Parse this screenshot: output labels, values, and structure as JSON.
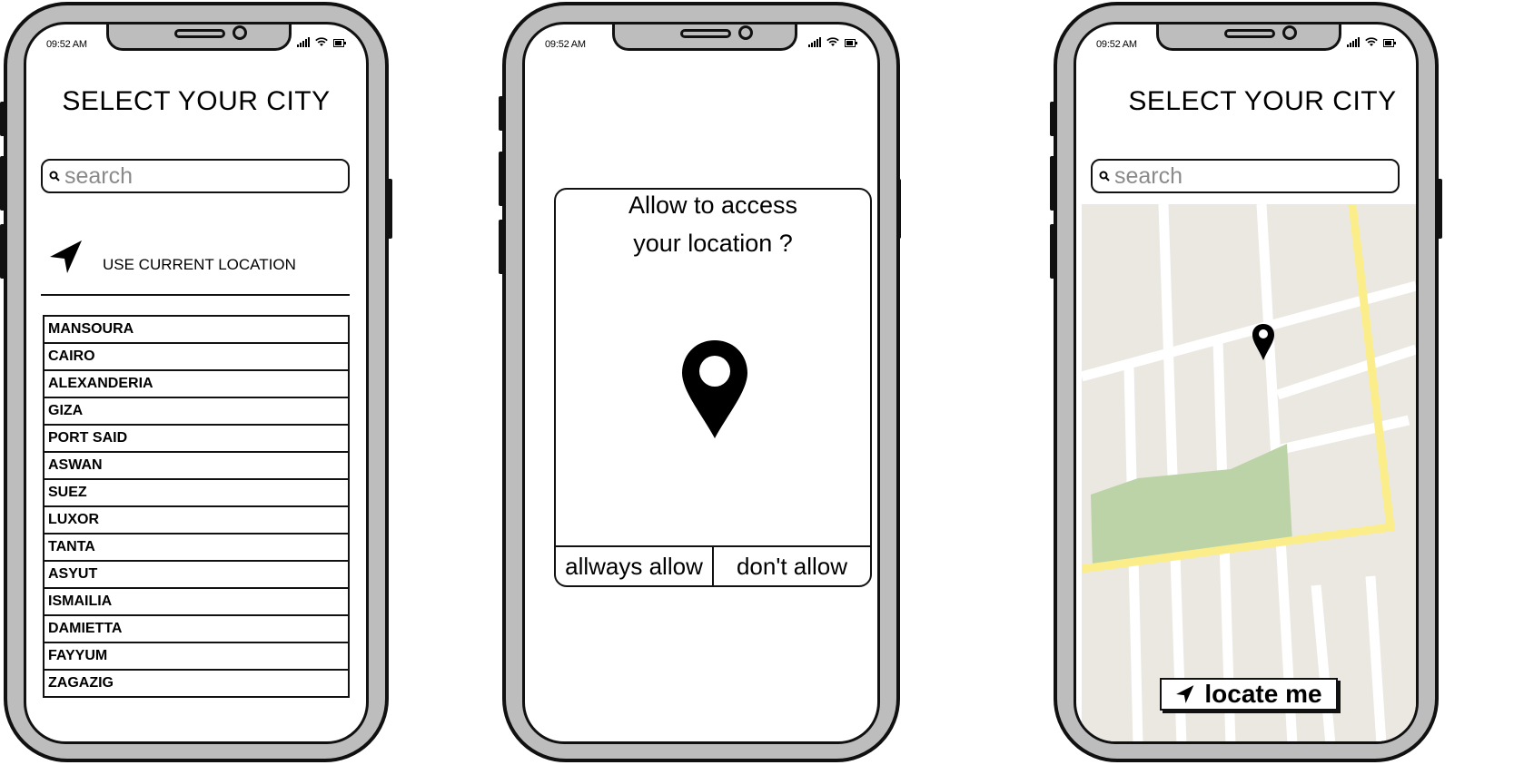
{
  "status_bar": {
    "time": "09:52 AM"
  },
  "screen1": {
    "title": "SELECT YOUR CITY",
    "search_placeholder": "search",
    "use_current_location_label": "USE CURRENT LOCATION",
    "cities": [
      "MANSOURA",
      "CAIRO",
      "ALEXANDERIA",
      "GIZA",
      "PORT SAID",
      "ASWAN",
      "SUEZ",
      "LUXOR",
      "TANTA",
      "ASYUT",
      "ISMAILIA",
      "DAMIETTA",
      "FAYYUM",
      "ZAGAZIG"
    ]
  },
  "screen2": {
    "dialog_line1": "Allow to access",
    "dialog_line2": "your location ?",
    "allow_label": "allways allow",
    "deny_label": "don't allow"
  },
  "screen3": {
    "title": "SELECT YOUR CITY",
    "search_placeholder": "search",
    "locate_label": "locate me"
  },
  "colors": {
    "frame": "#bdbdbd",
    "map_bg": "#ebe8e1",
    "road": "#ffffff",
    "highway": "#fbee8a",
    "park": "#bcd3a8"
  }
}
